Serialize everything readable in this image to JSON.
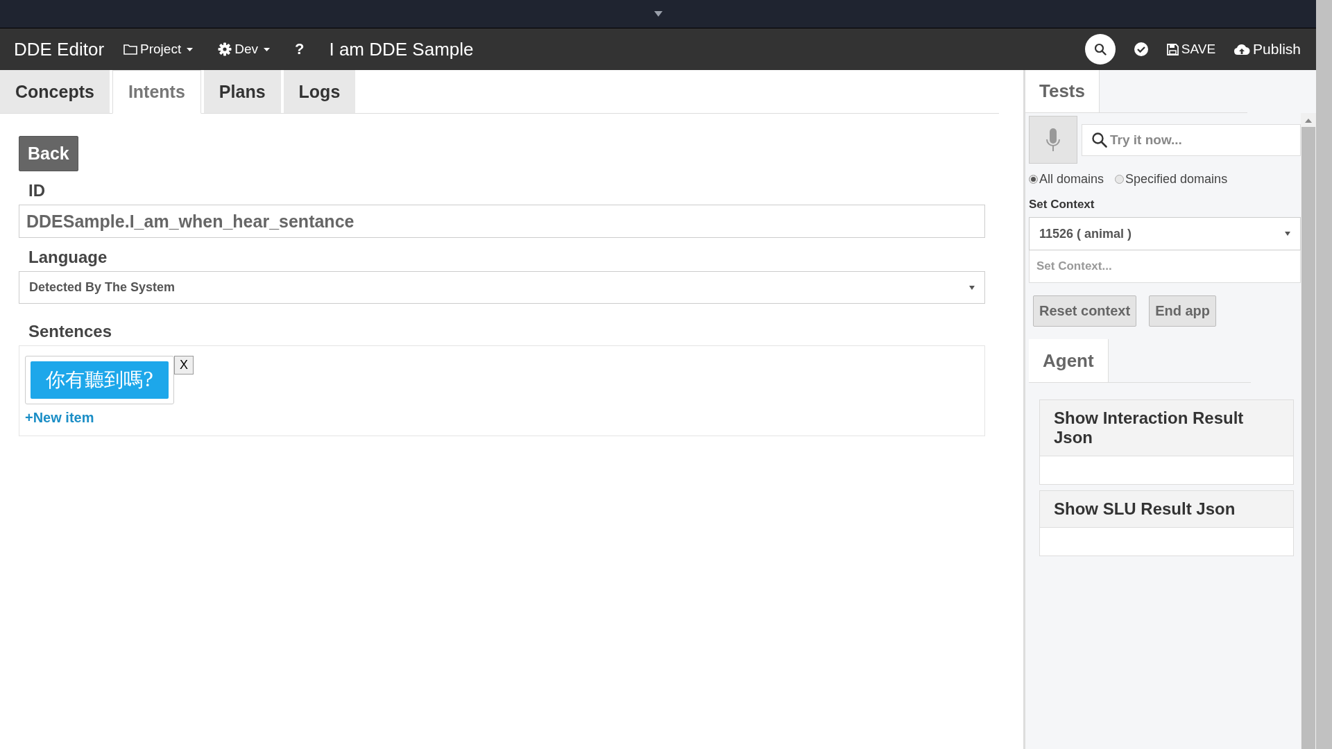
{
  "navbar": {
    "brand": "DDE Editor",
    "project_menu": {
      "label": "Project"
    },
    "dev_menu": {
      "label": "Dev"
    },
    "help": "?",
    "project_title": "I am DDE Sample",
    "save": "SAVE",
    "publish": "Publish"
  },
  "tabs": [
    {
      "label": "Concepts",
      "selected": false
    },
    {
      "label": "Intents",
      "selected": true
    },
    {
      "label": "Plans",
      "selected": false
    },
    {
      "label": "Logs",
      "selected": false
    }
  ],
  "form": {
    "back_button": "Back",
    "id": {
      "label": "ID",
      "value": "DDESample.I_am_when_hear_sentance"
    },
    "language": {
      "label": "Language",
      "value": "Detected By The System"
    },
    "sentences": {
      "label": "Sentences",
      "items": [
        {
          "text": "你有聽到嗎?",
          "remove": "X"
        }
      ],
      "new_item": "+New item"
    }
  },
  "test_panel": {
    "tabs": [
      {
        "label": "Tests",
        "selected": true
      }
    ],
    "search": {
      "placeholder": "Try it now..."
    },
    "domains": [
      {
        "label": "All domains",
        "selected": true
      },
      {
        "label": "Specified domains",
        "selected": false
      }
    ],
    "set_context": {
      "label": "Set Context",
      "select_value": "11526 ( animal )",
      "input_placeholder": "Set Context..."
    },
    "buttons": [
      "Reset context",
      "End app"
    ],
    "agent_tabs": [
      {
        "label": "Agent",
        "selected": true
      }
    ],
    "result_panels": [
      {
        "title": "Show Interaction Result Json"
      },
      {
        "title": "Show SLU Result Json"
      }
    ]
  }
}
